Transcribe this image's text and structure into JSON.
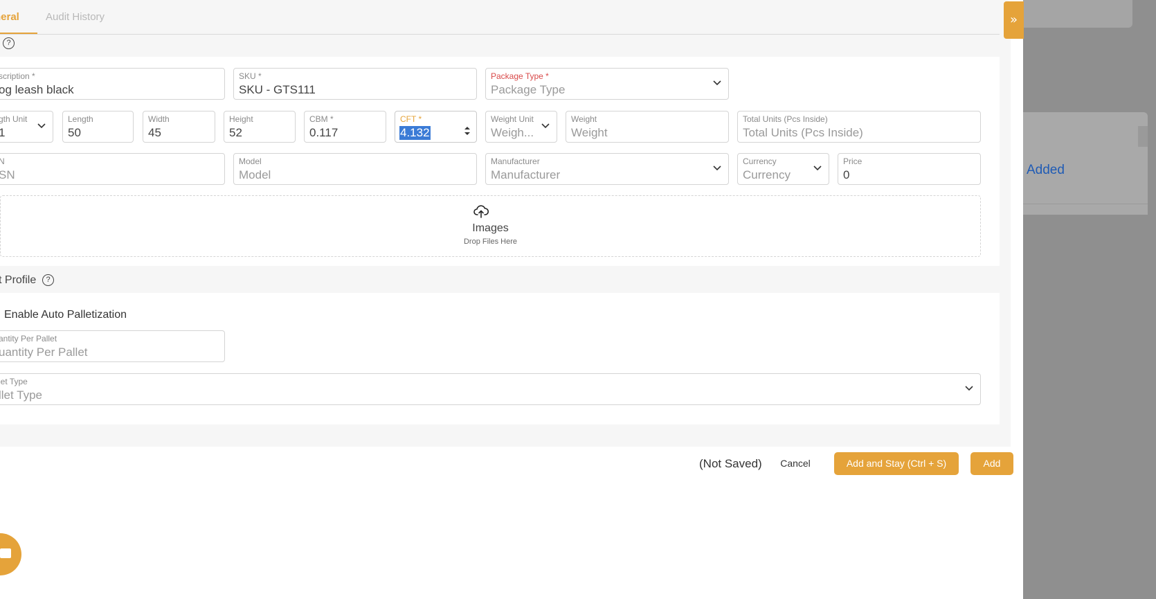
{
  "tabs": {
    "general": "neral",
    "audit_history": "Audit History"
  },
  "general_section": {
    "description": {
      "label": "scription *",
      "value": "og leash black"
    },
    "sku": {
      "label": "SKU *",
      "value": "SKU - GTS111"
    },
    "package_type": {
      "label": "Package Type *",
      "placeholder": "Package Type"
    },
    "length_unit": {
      "label": "gth Unit",
      "value": "1"
    },
    "length": {
      "label": "Length",
      "value": "50"
    },
    "width": {
      "label": "Width",
      "value": "45"
    },
    "height": {
      "label": "Height",
      "value": "52"
    },
    "cbm": {
      "label": "CBM *",
      "value": "0.117"
    },
    "cft": {
      "label": "CFT *",
      "value": "4.132"
    },
    "weight_unit": {
      "label": "Weight Unit",
      "placeholder": "Weigh..."
    },
    "weight": {
      "label": "Weight",
      "placeholder": "Weight"
    },
    "total_units": {
      "label": "Total Units (Pcs Inside)",
      "placeholder": "Total Units (Pcs Inside)"
    },
    "upc": {
      "label": "N",
      "placeholder": "SN"
    },
    "model": {
      "label": "Model",
      "placeholder": "Model"
    },
    "manufacturer": {
      "label": "Manufacturer",
      "placeholder": "Manufacturer"
    },
    "currency": {
      "label": "Currency",
      "placeholder": "Currency"
    },
    "price": {
      "label": "Price",
      "value": "0"
    },
    "images": {
      "title": "Images",
      "subtitle": "Drop Files Here"
    }
  },
  "pallet_section": {
    "title": "t Profile",
    "enable_auto_palletization": "Enable Auto Palletization",
    "quantity_per_pallet": {
      "label": "antity Per Pallet",
      "placeholder": "uantity Per Pallet"
    },
    "pallet_type": {
      "label": "let Type",
      "placeholder": "llet Type"
    }
  },
  "footer": {
    "status": "(Not Saved)",
    "cancel": "Cancel",
    "add_and_stay": "Add and Stay (Ctrl + S)",
    "add": "Add"
  },
  "collapse_glyph": "»",
  "help_glyph": "?",
  "background": {
    "added_text": "Added"
  },
  "colors": {
    "accent": "#e5a33a",
    "required_red": "#d94a4a",
    "link_blue": "#1f5bb5",
    "selection_blue": "#3b7bd6"
  }
}
